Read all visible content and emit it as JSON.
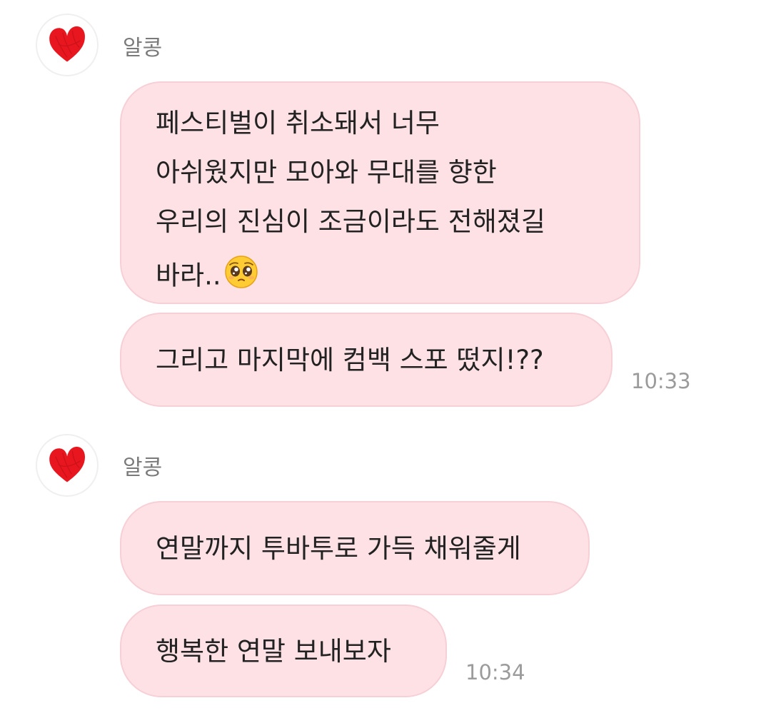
{
  "messages": [
    {
      "sender": "알콩",
      "bubbles": [
        {
          "lines": [
            "페스티벌이 취소돼서 너무",
            "아쉬웠지만 모아와 무대를 향한",
            "우리의 진심이 조금이라도 전해졌길",
            "바라.."
          ],
          "emoji": "pleading-face-icon"
        },
        {
          "text": "그리고 마지막에 컴백 스포 떴지!??"
        }
      ],
      "time": "10:33"
    },
    {
      "sender": "알콩",
      "bubbles": [
        {
          "text": "연말까지 투바투로 가득 채워줄게"
        },
        {
          "text": "행복한 연말 보내보자"
        }
      ],
      "time": "10:34"
    }
  ],
  "colors": {
    "bubble": "#fde1e5",
    "bubble_border": "#f7cfd6",
    "sender_name": "#7a7a7a",
    "timestamp": "#9b9b9b",
    "heart": "#e8161f"
  }
}
